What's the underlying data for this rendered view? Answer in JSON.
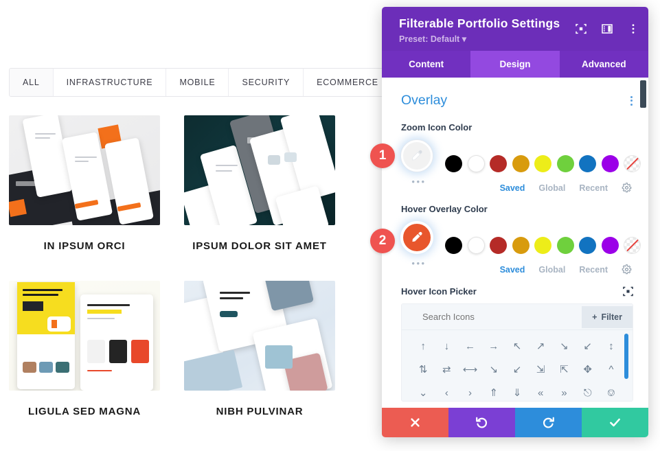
{
  "portfolio": {
    "filters": [
      {
        "label": "ALL",
        "active": true
      },
      {
        "label": "INFRASTRUCTURE",
        "active": false
      },
      {
        "label": "MOBILE",
        "active": false
      },
      {
        "label": "SECURITY",
        "active": false
      },
      {
        "label": "ECOMMERCE",
        "active": false
      }
    ],
    "items": [
      {
        "title": "IN IPSUM ORCI",
        "thumb": "mobile-app-dark-orange-mockup"
      },
      {
        "title": "IPSUM DOLOR SIT AMET",
        "thumb": "ecommerce-phones-teal-mockup"
      },
      {
        "title": "LIGULA SED MAGNA",
        "thumb": "yellow-landing-pages-mockup"
      },
      {
        "title": "NIBH PULVINAR",
        "thumb": "sunglasses-shop-blue-mockup"
      }
    ]
  },
  "modal": {
    "title": "Filterable Portfolio Settings",
    "preset": "Preset: Default",
    "preset_caret": "▾",
    "header_icons": [
      "focus-target-icon",
      "layout-panel-icon",
      "kebab-menu-icon"
    ],
    "tabs": [
      {
        "label": "Content",
        "active": false
      },
      {
        "label": "Design",
        "active": true
      },
      {
        "label": "Advanced",
        "active": false
      }
    ],
    "section": {
      "title": "Overlay",
      "menu_icon": "section-kebab-icon"
    },
    "zoom_icon_color": {
      "label": "Zoom Icon Color",
      "picker_icon": "eyedropper-icon",
      "picker_value": "#ffffff",
      "more_dots": "•••",
      "swatches": [
        "#000000",
        "#ffffff",
        "#b52b27",
        "#d89b0e",
        "#eded19",
        "#6fd03d",
        "#1273c0",
        "#9b00e8",
        "none"
      ],
      "links": [
        {
          "label": "Saved",
          "active": true
        },
        {
          "label": "Global",
          "active": false
        },
        {
          "label": "Recent",
          "active": false
        }
      ],
      "gear_icon": "gear-icon"
    },
    "hover_overlay_color": {
      "label": "Hover Overlay Color",
      "picker_icon": "eyedropper-icon",
      "picker_value": "#e8562c",
      "more_dots": "•••",
      "swatches": [
        "#000000",
        "#ffffff",
        "#b52b27",
        "#d89b0e",
        "#eded19",
        "#6fd03d",
        "#1273c0",
        "#9b00e8",
        "none"
      ],
      "links": [
        {
          "label": "Saved",
          "active": true
        },
        {
          "label": "Global",
          "active": false
        },
        {
          "label": "Recent",
          "active": false
        }
      ],
      "gear_icon": "gear-icon"
    },
    "hover_icon_picker": {
      "label": "Hover Icon Picker",
      "reset_icon": "focus-target-icon",
      "search_placeholder": "Search Icons",
      "search_value": "",
      "filter_label": "Filter",
      "filter_plus": "+",
      "icons": [
        "arrow-up",
        "arrow-down",
        "arrow-left",
        "arrow-right",
        "arrow-up-left",
        "arrow-up-right",
        "arrow-down-right",
        "arrow-down-left",
        "arrows-vertical",
        "arrows-up-down",
        "arrows-swap",
        "arrows-horizontal",
        "arrow-expand-down-right",
        "arrow-expand-down-left",
        "arrows-collapse",
        "arrows-expand",
        "arrows-move",
        "chevron-up",
        "chevron-down",
        "chevron-left",
        "chevron-right",
        "chevrons-up",
        "chevrons-down",
        "chevrons-left",
        "chevrons-right",
        "circle-chevron-up",
        "circle-chevron-down"
      ]
    },
    "footer": [
      {
        "name": "cancel",
        "icon": "✖"
      },
      {
        "name": "undo",
        "icon": "↺"
      },
      {
        "name": "redo",
        "icon": "↻"
      },
      {
        "name": "save",
        "icon": "✔"
      }
    ]
  },
  "badges": [
    {
      "number": "1",
      "target": "zoom-icon-color-picker"
    },
    {
      "number": "2",
      "target": "hover-overlay-color-picker"
    }
  ]
}
